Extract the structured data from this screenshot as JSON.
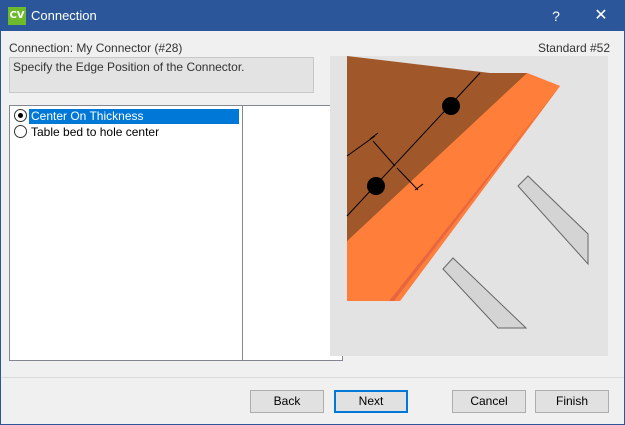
{
  "window": {
    "app_icon": "CV",
    "title": "Connection",
    "help_label": "?",
    "close_label": "✕"
  },
  "header": {
    "connection": "Connection: My Connector (#28)",
    "standard": "Standard #52"
  },
  "description": "Specify the Edge Position of the Connector.",
  "options": [
    {
      "label": "Center On Thickness",
      "selected": true
    },
    {
      "label": "Table bed to hole center",
      "selected": false
    }
  ],
  "buttons": {
    "back": "Back",
    "next": "Next",
    "cancel": "Cancel",
    "finish": "Finish"
  },
  "colors": {
    "titlebar": "#2b579a",
    "selection": "#0078d7",
    "board_top": "#a0582b",
    "board_face": "#ff7f3a",
    "board_side": "#e8663f"
  }
}
